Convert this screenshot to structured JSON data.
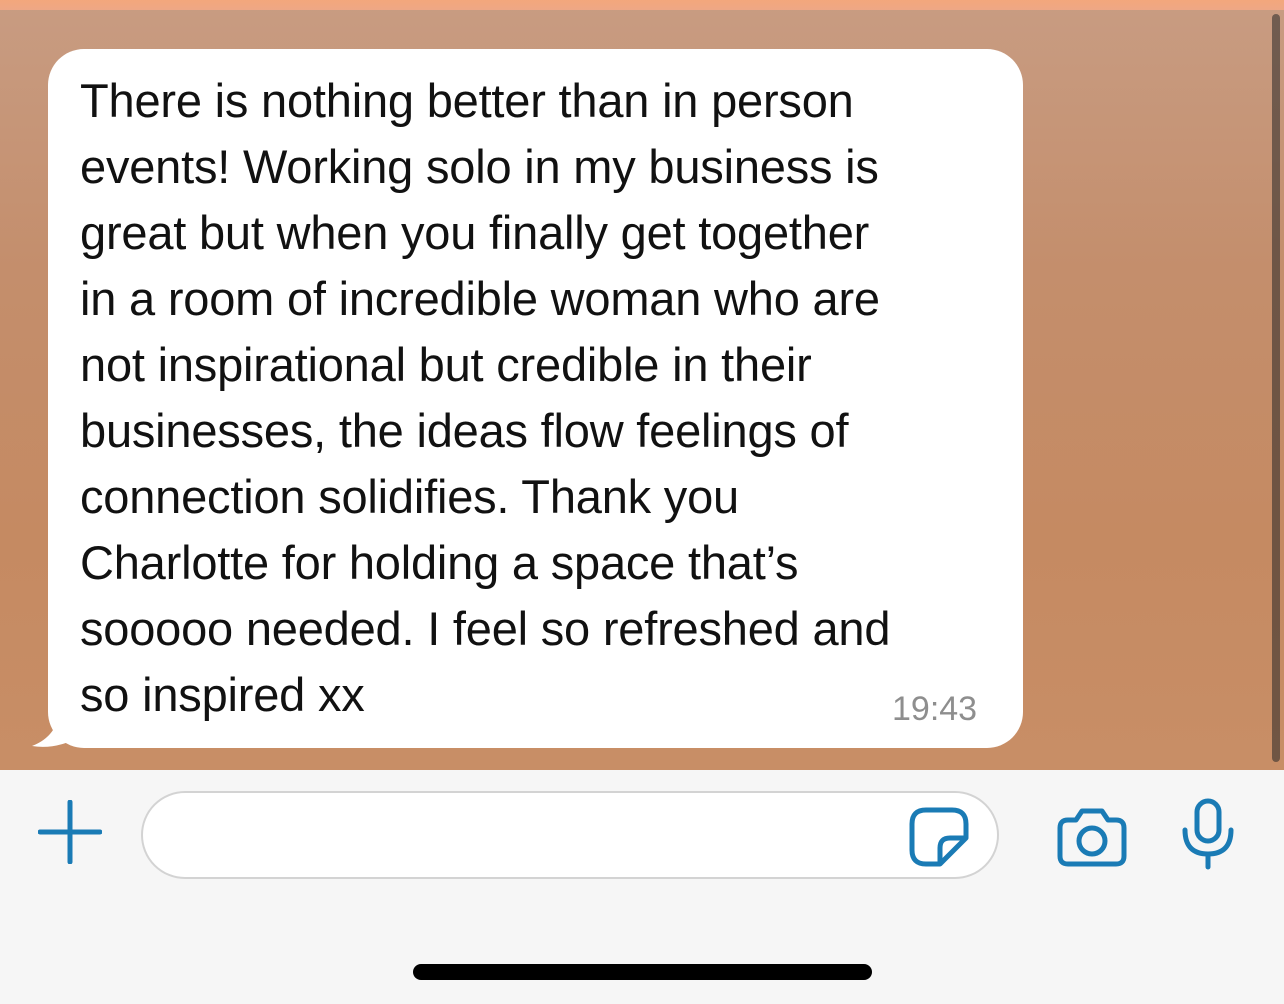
{
  "message": {
    "lines": [
      "There is nothing better than in person",
      "events! Working solo in my business is",
      "great but when you finally get together",
      "in a room of incredible woman who are",
      "not inspirational but credible in their",
      "businesses, the ideas flow feelings of",
      "connection solidifies. Thank you",
      "Charlotte for holding a space that’s",
      "sooooo needed. I feel so refreshed and",
      "so inspired xx"
    ],
    "time": "19:43"
  },
  "input_bar": {
    "plus_icon": "plus-icon",
    "sticker_icon": "sticker-icon",
    "camera_icon": "camera-icon",
    "mic_icon": "microphone-icon",
    "accent_color": "#1a7bb5"
  },
  "colors": {
    "bubble": "#ffffff",
    "wallpaper": "#c58a62",
    "time_text": "#8e8e8e"
  }
}
